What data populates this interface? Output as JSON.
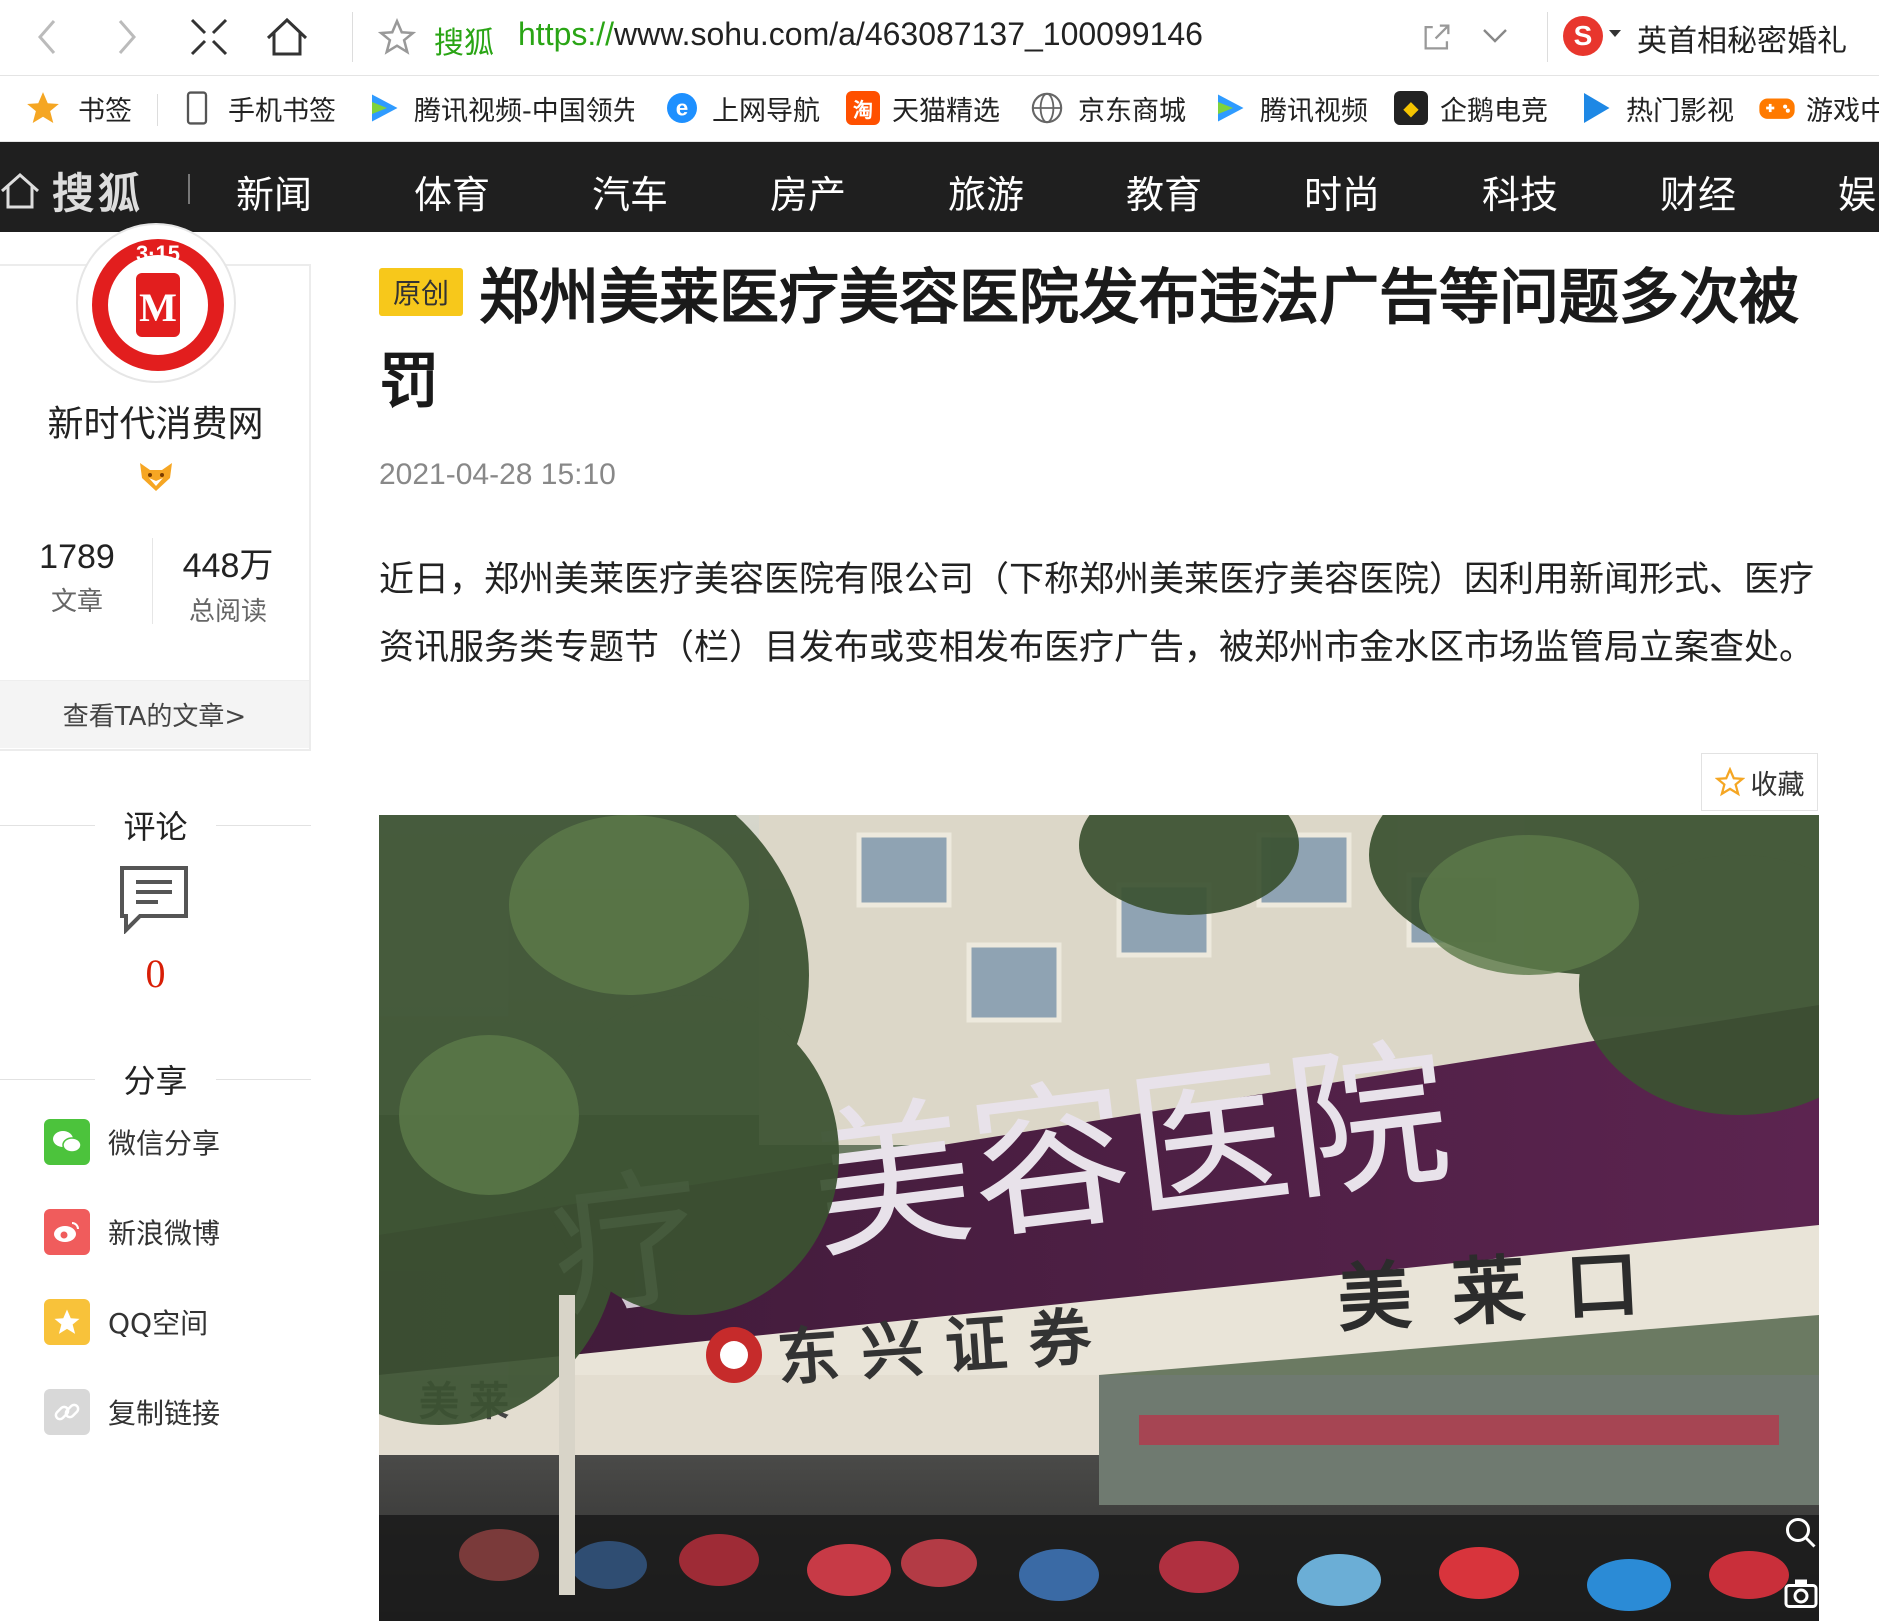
{
  "browser": {
    "site_name": "搜狐",
    "url_protocol": "https://",
    "url_rest": "www.sohu.com/a/463087137_100099146",
    "search_hint": "英首相秘密婚礼"
  },
  "bookmarks": [
    {
      "label": "书签",
      "icon": "star-icon",
      "color": "#f5a623"
    },
    {
      "label": "手机书签",
      "icon": "phone-icon",
      "color": "#555555"
    },
    {
      "label": "腾讯视频-中国领先",
      "icon": "tencent-video-icon",
      "color": "#2f9bff"
    },
    {
      "label": "上网导航",
      "icon": "ie-icon",
      "color": "#1e90ff"
    },
    {
      "label": "天猫精选",
      "icon": "taobao-icon",
      "color": "#ff5000"
    },
    {
      "label": "京东商城",
      "icon": "globe-icon",
      "color": "#666666"
    },
    {
      "label": "腾讯视频",
      "icon": "tencent-video-icon",
      "color": "#2f9bff"
    },
    {
      "label": "企鹅电竞",
      "icon": "penguin-esports-icon",
      "color": "#222222"
    },
    {
      "label": "热门影视",
      "icon": "play-icon",
      "color": "#1e88e5"
    },
    {
      "label": "游戏中",
      "icon": "gamepad-icon",
      "color": "#ff7a00"
    }
  ],
  "site_nav": {
    "logo": "搜狐",
    "items": [
      "新闻",
      "体育",
      "汽车",
      "房产",
      "旅游",
      "教育",
      "时尚",
      "科技",
      "财经",
      "娱"
    ]
  },
  "author": {
    "name": "新时代消费网",
    "articles_count": "1789",
    "articles_label": "文章",
    "reads_count": "448万",
    "reads_label": "总阅读",
    "view_articles": "查看TA的文章>",
    "avatar_text": "3·15"
  },
  "sidebar": {
    "comment_heading": "评论",
    "comment_count": "0",
    "share_heading": "分享",
    "share_items": [
      {
        "label": "微信分享",
        "icon": "wechat-icon",
        "color": "#4cc33c"
      },
      {
        "label": "新浪微博",
        "icon": "weibo-icon",
        "color": "#f05c5c"
      },
      {
        "label": "QQ空间",
        "icon": "qzone-icon",
        "color": "#f8c23a"
      },
      {
        "label": "复制链接",
        "icon": "link-icon",
        "color": "#d8d8d8"
      }
    ]
  },
  "article": {
    "tag": "原创",
    "title": "郑州美莱医疗美容医院发布违法广告等问题多次被罚",
    "published": "2021-04-28 15:10",
    "lead": "近日，郑州美莱医疗美容医院有限公司（下称郑州美莱医疗美容医院）因利用新闻形式、医疗资讯服务类专题节（栏）目发布或变相发布医疗广告，被郑州市金水区市场监管局立案查处。",
    "favorite": "收藏",
    "image": {
      "sign_text": "美容医院",
      "sign_partial": "疗",
      "store_left": "东兴证券",
      "store_right": "美莱口",
      "store_small": "美莱"
    }
  }
}
